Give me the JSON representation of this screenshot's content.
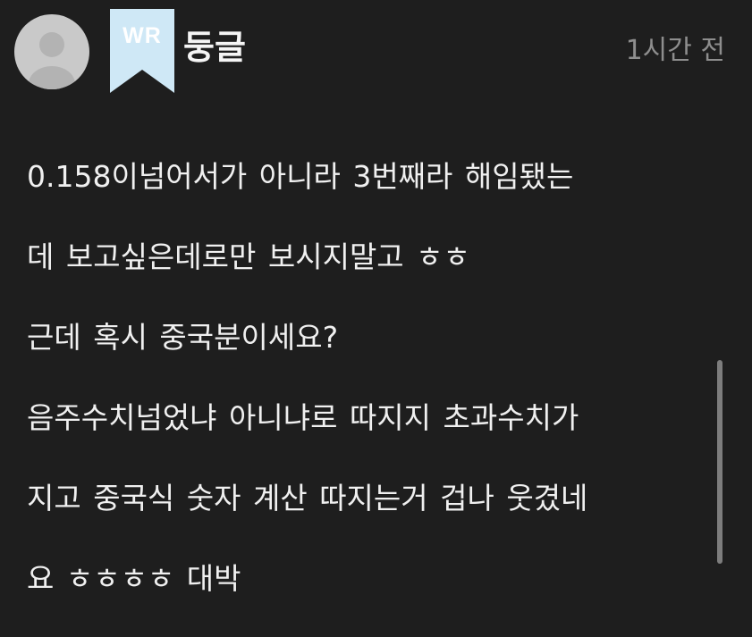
{
  "comment": {
    "author": "둥글",
    "badge": "WR",
    "time": "1시간 전",
    "lines": [
      "0.158이넘어서가  아니라  3번째라  해임됐는",
      "데 보고싶은데로만 보시지말고 ㅎㅎ",
      "근데 혹시 중국분이세요?",
      "음주수치넘었냐 아니냐로 따지지 초과수치가",
      "지고 중국식 숫자 계산 따지는거 겁나 웃겼네",
      "요 ㅎㅎㅎㅎ 대박"
    ]
  },
  "colors": {
    "background": "#1e1e1e",
    "badge": "#cfe8f6",
    "avatar": "#c9c9c9",
    "avatar_glyph": "#b0b0b0",
    "timestamp": "#8e8e8e",
    "scrollbar": "#7d7d7d"
  }
}
